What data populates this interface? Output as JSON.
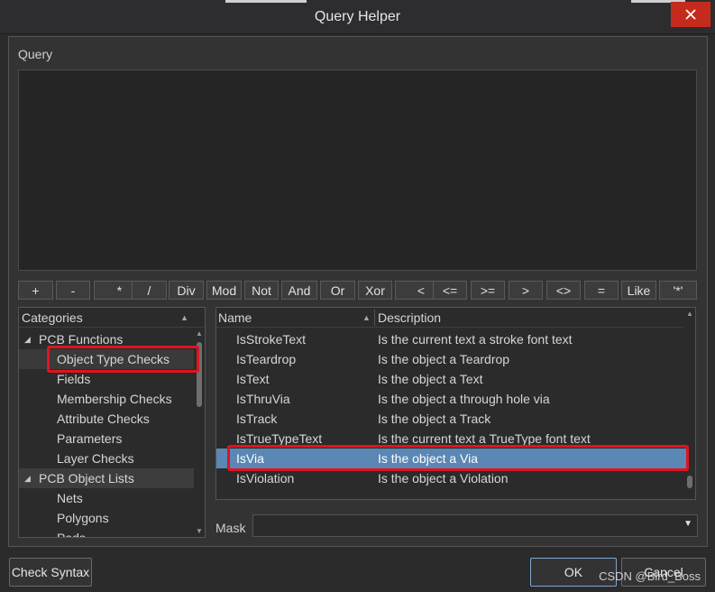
{
  "window": {
    "title": "Query Helper"
  },
  "query": {
    "label": "Query",
    "value": ""
  },
  "operators": [
    "+",
    "-",
    "*",
    "/",
    "Div",
    "Mod",
    "Not",
    "And",
    "Or",
    "Xor",
    "<",
    "<=",
    ">=",
    ">",
    "<>",
    "=",
    "Like",
    "'*'"
  ],
  "categories": {
    "header": "Categories",
    "items": [
      {
        "label": "PCB Functions",
        "level": 1,
        "expanded": true
      },
      {
        "label": "Object Type Checks",
        "level": 2,
        "selected": true
      },
      {
        "label": "Fields",
        "level": 2
      },
      {
        "label": "Membership Checks",
        "level": 2
      },
      {
        "label": "Attribute Checks",
        "level": 2
      },
      {
        "label": "Parameters",
        "level": 2
      },
      {
        "label": "Layer Checks",
        "level": 2
      },
      {
        "label": "PCB Object Lists",
        "level": 1,
        "expanded": true
      },
      {
        "label": "Nets",
        "level": 2
      },
      {
        "label": "Polygons",
        "level": 2
      },
      {
        "label": "Pads",
        "level": 2
      }
    ]
  },
  "list": {
    "col_name": "Name",
    "col_desc": "Description",
    "rows": [
      {
        "name": "IsStrokeText",
        "desc": "Is the current text a stroke font text"
      },
      {
        "name": "IsTeardrop",
        "desc": "Is the object a Teardrop"
      },
      {
        "name": "IsText",
        "desc": "Is the object a Text"
      },
      {
        "name": "IsThruVia",
        "desc": "Is the object a through hole via"
      },
      {
        "name": "IsTrack",
        "desc": "Is the object a Track"
      },
      {
        "name": "IsTrueTypeText",
        "desc": "Is the current text a TrueType font text"
      },
      {
        "name": "IsVia",
        "desc": "Is the object a Via",
        "selected": true
      },
      {
        "name": "IsViolation",
        "desc": "Is the object a Violation"
      }
    ]
  },
  "mask": {
    "label": "Mask",
    "value": ""
  },
  "buttons": {
    "check_syntax": "Check Syntax",
    "ok": "OK",
    "cancel": "Cancel"
  },
  "watermark": "CSDN @Bird_Boss",
  "colors": {
    "selection": "#5a87b4",
    "highlight_box": "#e0141e",
    "close": "#c42b1c"
  }
}
